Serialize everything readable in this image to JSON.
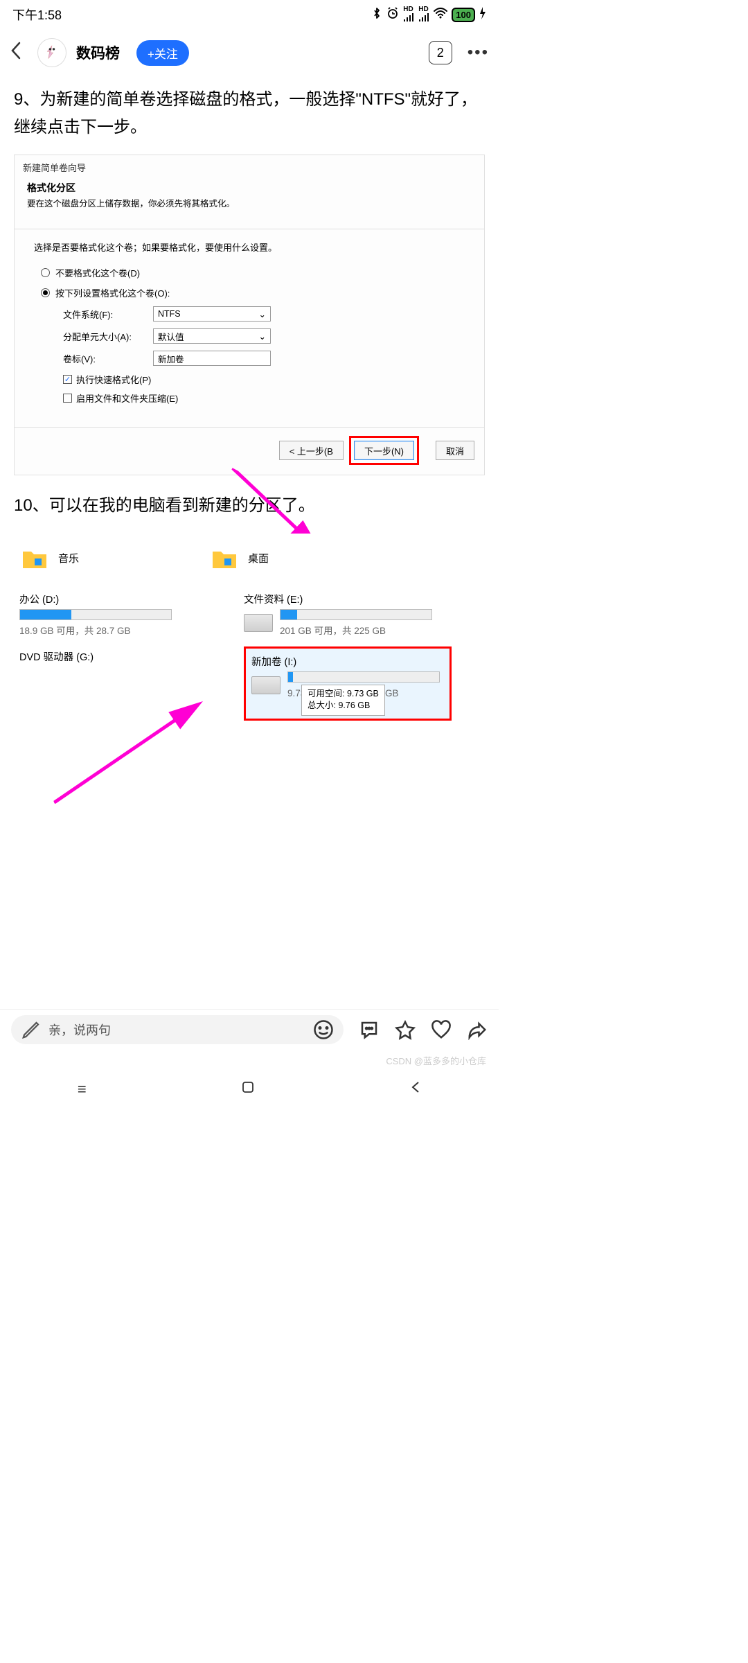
{
  "status_bar": {
    "time": "下午1:58",
    "battery": "100"
  },
  "header": {
    "author": "数码榜",
    "follow_label": "+关注",
    "page_indicator": "2"
  },
  "article": {
    "step9": "9、为新建的简单卷选择磁盘的格式，一般选择\"NTFS\"就好了，继续点击下一步。",
    "step10": "10、可以在我的电脑看到新建的分区了。"
  },
  "wizard": {
    "title": "新建简单卷向导",
    "heading": "格式化分区",
    "subheading": "要在这个磁盘分区上储存数据，你必须先将其格式化。",
    "instruction": "选择是否要格式化这个卷；如果要格式化，要使用什么设置。",
    "radio1": "不要格式化这个卷(D)",
    "radio2": "按下列设置格式化这个卷(O):",
    "filesystem_label": "文件系统(F):",
    "filesystem_value": "NTFS",
    "blocksize_label": "分配单元大小(A):",
    "blocksize_value": "默认值",
    "volname_label": "卷标(V):",
    "volname_value": "新加卷",
    "quickformat": "执行快速格式化(P)",
    "compress": "启用文件和文件夹压缩(E)",
    "btn_back": "< 上一步(B",
    "btn_next": "下一步(N)",
    "btn_cancel": "取消"
  },
  "drives": {
    "lib_music": "音乐",
    "lib_desktop": "桌面",
    "drive_d_name": "办公 (D:)",
    "drive_d_stats": "18.9 GB 可用，共 28.7 GB",
    "drive_d_fill": 34,
    "drive_e_name": "文件资料 (E:)",
    "drive_e_stats": "201 GB 可用，共 225 GB",
    "drive_e_fill": 11,
    "drive_g_name": "DVD 驱动器 (G:)",
    "drive_i_name": "新加卷 (I:)",
    "drive_i_stats": "9.73 GB 可用，共 9.76 GB",
    "drive_i_fill": 3,
    "tooltip_line1": "可用空间: 9.73 GB",
    "tooltip_line2": "总大小: 9.76 GB"
  },
  "input_bar": {
    "placeholder": "亲，说两句"
  },
  "watermark": "CSDN @蓝多多的小仓库"
}
